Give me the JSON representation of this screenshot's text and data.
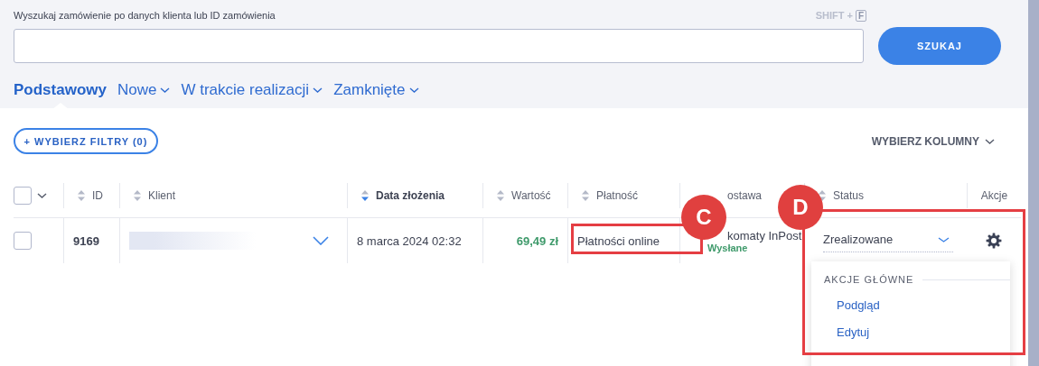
{
  "search": {
    "label": "Wyszukaj zamówienie po danych klienta lub ID zamówienia",
    "shortcut": "SHIFT +",
    "shortcut_key": "F",
    "button": "SZUKAJ"
  },
  "tabs": [
    {
      "label": "Podstawowy",
      "selected": true,
      "dropdown": false
    },
    {
      "label": "Nowe",
      "selected": false,
      "dropdown": true
    },
    {
      "label": "W trakcie realizacji",
      "selected": false,
      "dropdown": true
    },
    {
      "label": "Zamknięte",
      "selected": false,
      "dropdown": true
    }
  ],
  "filter_button": "+ WYBIERZ FILTRY (0)",
  "columns_button": "WYBIERZ KOLUMNY",
  "table": {
    "select_all": {
      "checked": false
    },
    "columns": [
      {
        "label": "ID",
        "kind": "sortable",
        "sorted": false
      },
      {
        "label": "Klient",
        "kind": "sortable",
        "sorted": false
      },
      {
        "label": "Data złożenia",
        "kind": "sortable",
        "sorted": true
      },
      {
        "label": "Wartość",
        "kind": "sortable",
        "sorted": false
      },
      {
        "label": "Płatność",
        "kind": "sortable",
        "sorted": false
      },
      {
        "label": "ostawa",
        "kind": "covered"
      },
      {
        "label": "Status",
        "kind": "sortable",
        "sorted": false
      },
      {
        "label": "Akcje",
        "kind": "plain"
      }
    ],
    "rows": [
      {
        "checked": false,
        "id": "9169",
        "date": "8 marca 2024 02:32",
        "value": "69,49 zł",
        "payment": "Płatności online",
        "delivery": "komaty InPost",
        "delivery_status": "Wysłane",
        "status": "Zrealizowane"
      }
    ]
  },
  "action_menu": {
    "heading": "AKCJE GŁÓWNE",
    "items": [
      "Podgląd",
      "Edytuj"
    ]
  },
  "annotations": [
    {
      "label": "C",
      "kind": "small"
    },
    {
      "label": "D",
      "kind": "large"
    }
  ]
}
